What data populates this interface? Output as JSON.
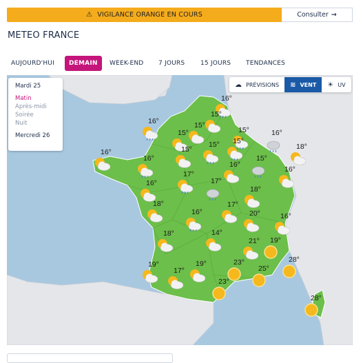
{
  "alert": {
    "text": "VIGILANCE ORANGE EN COURS",
    "icon": "warning-icon",
    "color": "#f4ab1c"
  },
  "consult": {
    "label": "Consulter",
    "arrow": "→"
  },
  "page_title": "METEO FRANCE",
  "tabs": [
    {
      "label": "AUJOURD'HUI",
      "active": false
    },
    {
      "label": "DEMAIN",
      "active": true
    },
    {
      "label": "WEEK-END",
      "active": false
    },
    {
      "label": "7 JOURS",
      "active": false
    },
    {
      "label": "15 JOURS",
      "active": false
    },
    {
      "label": "TENDANCES",
      "active": false
    }
  ],
  "periods": {
    "day1": "Mardi 25",
    "slots": [
      "Matin",
      "Après-midi",
      "Soirée",
      "Nuit"
    ],
    "selected": "Matin",
    "day2": "Mercredi 26"
  },
  "layers": [
    {
      "label": "PRÉVISIONS",
      "icon": "cloud-sun-icon",
      "active": false
    },
    {
      "label": "VENT",
      "icon": "wind-icon",
      "active": true
    },
    {
      "label": "UV",
      "icon": "uv-sun-icon",
      "active": false
    }
  ],
  "colors": {
    "accent": "#c4157a",
    "active_layer": "#1a5aa6",
    "sea": "#a8c8e0",
    "land": "#6cbf4a",
    "neighbors": "#e4e6ea"
  },
  "forecasts": [
    {
      "temp": "16°",
      "icon": "sun-cloud-rain-icon"
    },
    {
      "temp": "15°",
      "icon": "sun-cloud-icon"
    },
    {
      "temp": "16°",
      "icon": "sun-cloud-rain-icon"
    },
    {
      "temp": "15°",
      "icon": "sun-cloud-icon"
    },
    {
      "temp": "15°",
      "icon": "sun-cloud-rain-icon"
    },
    {
      "temp": "15°",
      "icon": "sun-cloud-icon"
    },
    {
      "temp": "15°",
      "icon": "sun-cloud-rain-icon"
    },
    {
      "temp": "16°",
      "icon": "cloud-rain-icon"
    },
    {
      "temp": "15°",
      "icon": "sun-cloud-icon"
    },
    {
      "temp": "15°",
      "icon": "sun-cloud-rain-icon"
    },
    {
      "temp": "18°",
      "icon": "sun-cloud-icon"
    },
    {
      "temp": "16°",
      "icon": "sun-cloud-icon"
    },
    {
      "temp": "16°",
      "icon": "sun-cloud-rain-icon"
    },
    {
      "temp": "15°",
      "icon": "cloud-rain-icon"
    },
    {
      "temp": "16°",
      "icon": "sun-cloud-icon"
    },
    {
      "temp": "16°",
      "icon": "sun-cloud-icon"
    },
    {
      "temp": "17°",
      "icon": "sun-cloud-rain-icon"
    },
    {
      "temp": "17°",
      "icon": "cloud-rain-icon"
    },
    {
      "temp": "18°",
      "icon": "sun-cloud-icon"
    },
    {
      "temp": "16°",
      "icon": "sun-cloud-icon"
    },
    {
      "temp": "18°",
      "icon": "sun-cloud-icon"
    },
    {
      "temp": "16°",
      "icon": "sun-cloud-rain-icon"
    },
    {
      "temp": "17°",
      "icon": "sun-cloud-icon"
    },
    {
      "temp": "20°",
      "icon": "sun-cloud-icon"
    },
    {
      "temp": "16°",
      "icon": "sun-cloud-icon"
    },
    {
      "temp": "18°",
      "icon": "sun-cloud-icon"
    },
    {
      "temp": "14°",
      "icon": "sun-cloud-icon"
    },
    {
      "temp": "21°",
      "icon": "sun-cloud-icon"
    },
    {
      "temp": "19°",
      "icon": "sun-icon"
    },
    {
      "temp": "19°",
      "icon": "sun-cloud-icon"
    },
    {
      "temp": "19°",
      "icon": "sun-cloud-icon"
    },
    {
      "temp": "23°",
      "icon": "sun-icon"
    },
    {
      "temp": "28°",
      "icon": "sun-icon"
    },
    {
      "temp": "17°",
      "icon": "sun-cloud-icon"
    },
    {
      "temp": "25°",
      "icon": "sun-icon"
    },
    {
      "temp": "23°",
      "icon": "sun-icon"
    },
    {
      "temp": "28°",
      "icon": "sun-icon"
    }
  ]
}
